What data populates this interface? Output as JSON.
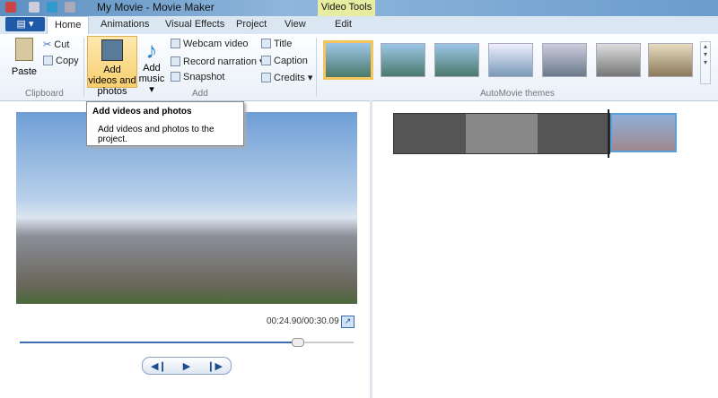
{
  "window": {
    "title": "My Movie - Movie Maker",
    "context_tab_group": "Video Tools"
  },
  "tabs": [
    "Home",
    "Animations",
    "Visual Effects",
    "Project",
    "View",
    "Edit"
  ],
  "ribbon": {
    "clipboard": {
      "label": "Clipboard",
      "paste": "Paste",
      "cut": "Cut",
      "copy": "Copy"
    },
    "add": {
      "label": "Add",
      "add_videos": "Add videos and photos",
      "add_music": "Add music",
      "webcam": "Webcam video",
      "narration": "Record narration",
      "snapshot": "Snapshot",
      "title": "Title",
      "caption": "Caption",
      "credits": "Credits"
    },
    "themes": {
      "label": "AutoMovie themes"
    }
  },
  "tooltip": {
    "title": "Add videos and photos",
    "body": "Add videos and photos to the project."
  },
  "player": {
    "time": "00:24.90/00:30.09",
    "progress": 0.83
  },
  "colors": {
    "accent": "#1f5aa8",
    "selection": "#f5c45a"
  }
}
